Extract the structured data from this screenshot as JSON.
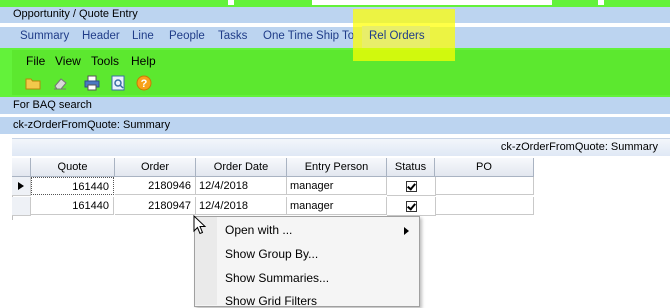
{
  "window": {
    "title": "Opportunity / Quote Entry"
  },
  "tabs": [
    {
      "label": "Summary"
    },
    {
      "label": "Header"
    },
    {
      "label": "Line"
    },
    {
      "label": "People"
    },
    {
      "label": "Tasks"
    },
    {
      "label": "One Time Ship To"
    },
    {
      "label": "Rel Orders"
    }
  ],
  "menu": [
    {
      "label": "File"
    },
    {
      "label": "View"
    },
    {
      "label": "Tools"
    },
    {
      "label": "Help"
    }
  ],
  "toolbar_icons": [
    "folder-icon",
    "eraser-icon",
    "print-icon",
    "print-preview-icon",
    "help-icon"
  ],
  "baq_label": "For BAQ search",
  "summary_header": "ck-zOrderFromQuote: Summary",
  "panel_title": "ck-zOrderFromQuote: Summary",
  "grid": {
    "columns": [
      "Quote",
      "Order",
      "Order Date",
      "Entry Person",
      "Status",
      "PO"
    ],
    "rows": [
      {
        "quote": "161440",
        "order": "2180946",
        "order_date": "12/4/2018",
        "entry_person": "manager",
        "status": true,
        "po": "",
        "current": true
      },
      {
        "quote": "161440",
        "order": "2180947",
        "order_date": "12/4/2018",
        "entry_person": "manager",
        "status": true,
        "po": "",
        "current": false
      }
    ]
  },
  "context_menu": [
    {
      "label": "Open with ...",
      "submenu": true
    },
    {
      "label": "Show Group By..."
    },
    {
      "label": "Show Summaries..."
    },
    {
      "label": "Show Grid Filters"
    }
  ],
  "colors": {
    "accent_green": "#63f23a",
    "header_blue": "#bcd4f0",
    "highlight": "#ffff00",
    "tab_text": "#1f3c88"
  }
}
